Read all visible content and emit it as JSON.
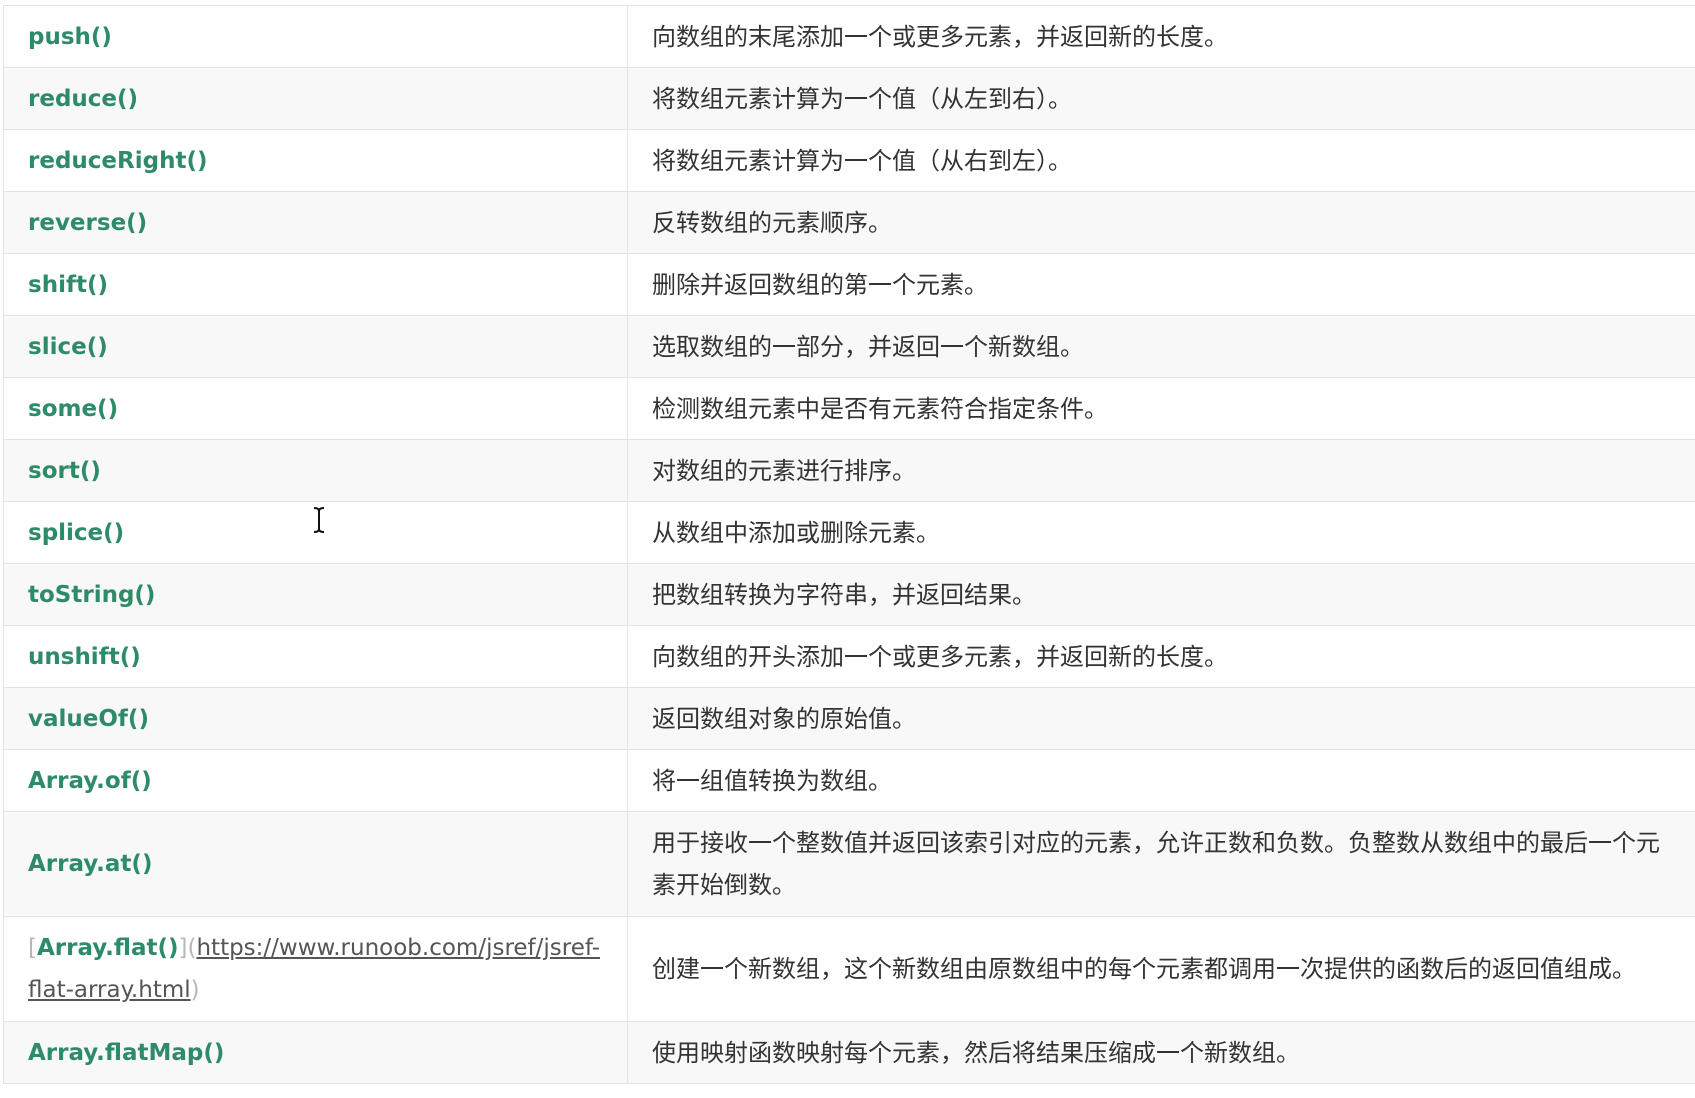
{
  "rows": [
    {
      "method": "push()",
      "description": "向数组的末尾添加一个或更多元素，并返回新的长度。"
    },
    {
      "method": "reduce()",
      "description": "将数组元素计算为一个值（从左到右）。"
    },
    {
      "method": "reduceRight()",
      "description": "将数组元素计算为一个值（从右到左）。"
    },
    {
      "method": "reverse()",
      "description": "反转数组的元素顺序。"
    },
    {
      "method": "shift()",
      "description": "删除并返回数组的第一个元素。"
    },
    {
      "method": "slice()",
      "description": "选取数组的一部分，并返回一个新数组。"
    },
    {
      "method": "some()",
      "description": "检测数组元素中是否有元素符合指定条件。"
    },
    {
      "method": "sort()",
      "description": "对数组的元素进行排序。"
    },
    {
      "method": "splice()",
      "description": "从数组中添加或删除元素。"
    },
    {
      "method": "toString()",
      "description": "把数组转换为字符串，并返回结果。"
    },
    {
      "method": "unshift()",
      "description": "向数组的开头添加一个或更多元素，并返回新的长度。"
    },
    {
      "method": "valueOf()",
      "description": "返回数组对象的原始值。"
    },
    {
      "method": "Array.of()",
      "description": "将一组值转换为数组。"
    },
    {
      "method": "Array.at()",
      "description": "用于接收一个整数值并返回该索引对应的元素，允许正数和负数。负整数从数组中的最后一个元素开始倒数。"
    },
    {
      "method_link": {
        "open_bracket": "[",
        "name": "Array.flat()",
        "close_bracket": "]",
        "open_paren": "(",
        "url": "https://www.runoob.com/jsref/jsref-flat-array.html",
        "close_paren": ")"
      },
      "description": "创建一个新数组，这个新数组由原数组中的每个元素都调用一次提供的函数后的返回值组成。"
    },
    {
      "method": "Array.flatMap()",
      "description": "使用映射函数映射每个元素，然后将结果压缩成一个新数组。"
    }
  ],
  "colors": {
    "method_text": "#2e8b68",
    "border": "#e3e3e3",
    "row_alt": "#f8f8f8"
  },
  "cursor_icon": "text-cursor-icon"
}
